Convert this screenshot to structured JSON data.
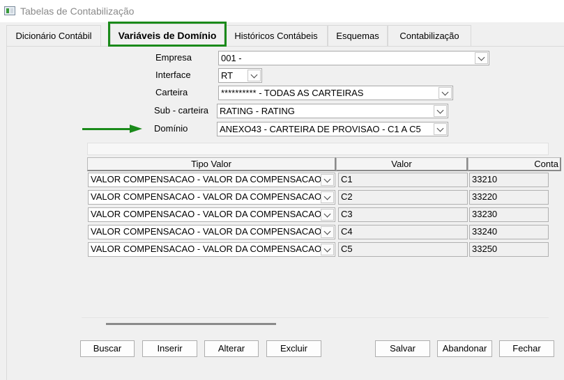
{
  "window": {
    "title": "Tabelas de Contabilização"
  },
  "tabs": [
    {
      "label": "Dicionário Contábil"
    },
    {
      "label": "Variáveis de Domínio",
      "active": true
    },
    {
      "label": "Históricos Contábeis"
    },
    {
      "label": "Esquemas"
    },
    {
      "label": "Contabilização"
    }
  ],
  "form": {
    "empresa": {
      "label": "Empresa",
      "value": "001 -"
    },
    "interface": {
      "label": "Interface",
      "value": "RT"
    },
    "carteira": {
      "label": "Carteira",
      "value": "********** - TODAS AS CARTEIRAS"
    },
    "sub_carteira": {
      "label": "Sub - carteira",
      "value": "RATING - RATING"
    },
    "dominio": {
      "label": "Domínio",
      "value": "ANEXO43 - CARTEIRA DE PROVISAO - C1 A C5"
    }
  },
  "grid": {
    "columns": [
      "Tipo Valor",
      "Valor",
      "Conta"
    ],
    "rows": [
      {
        "tipo": "VALOR COMPENSACAO - VALOR DA COMPENSACAO",
        "valor": "C1",
        "conta": "33210"
      },
      {
        "tipo": "VALOR COMPENSACAO - VALOR DA COMPENSACAO",
        "valor": "C2",
        "conta": "33220"
      },
      {
        "tipo": "VALOR COMPENSACAO - VALOR DA COMPENSACAO",
        "valor": "C3",
        "conta": "33230"
      },
      {
        "tipo": "VALOR COMPENSACAO - VALOR DA COMPENSACAO",
        "valor": "C4",
        "conta": "33240"
      },
      {
        "tipo": "VALOR COMPENSACAO - VALOR DA COMPENSACAO",
        "valor": "C5",
        "conta": "33250"
      }
    ]
  },
  "buttons": {
    "buscar": "Buscar",
    "inserir": "Inserir",
    "alterar": "Alterar",
    "excluir": "Excluir",
    "salvar": "Salvar",
    "abandonar": "Abandonar",
    "fechar": "Fechar"
  },
  "colors": {
    "highlight": "#1a8a1a"
  }
}
